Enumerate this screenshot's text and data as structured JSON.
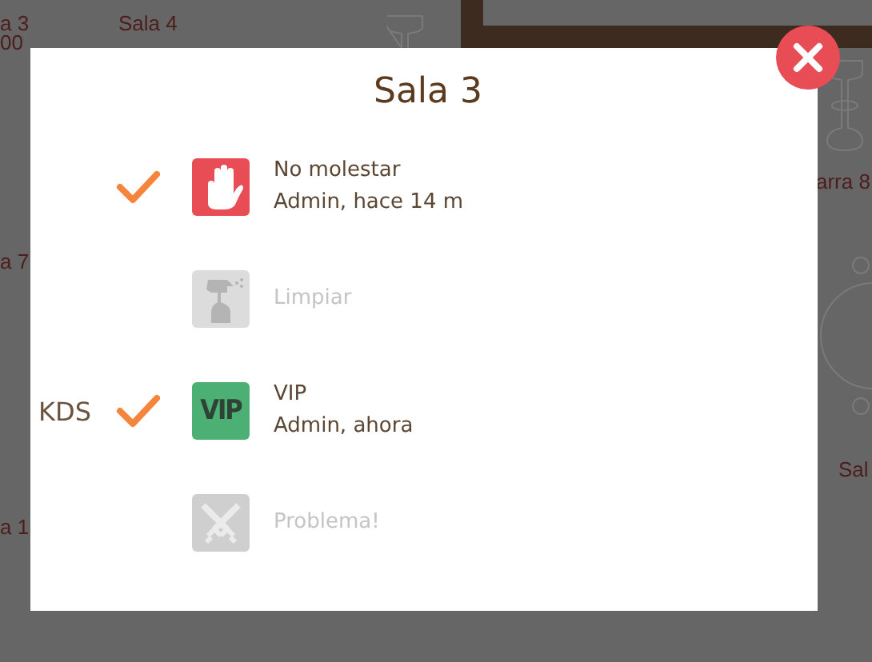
{
  "floor_plan": {
    "labels": [
      {
        "text": "a 3"
      },
      {
        "text": "00"
      },
      {
        "text": "Sala 4"
      },
      {
        "text": "a 7"
      },
      {
        "text": "arra 8"
      },
      {
        "text": "Sal"
      },
      {
        "text": "a 1"
      }
    ]
  },
  "dialog": {
    "title": "Sala 3",
    "items": [
      {
        "kind": "hand",
        "label": "No molestar",
        "detail": "Admin, hace 14 m",
        "checked": true,
        "active": true
      },
      {
        "kind": "spray",
        "label": "Limpiar",
        "checked": false,
        "active": false
      },
      {
        "kind": "vip",
        "icon_text": "VIP",
        "tag": "KDS",
        "label": "VIP",
        "detail": "Admin, ahora",
        "checked": true,
        "active": true
      },
      {
        "kind": "swords",
        "label": "Problema!",
        "checked": false,
        "active": false
      }
    ]
  }
}
